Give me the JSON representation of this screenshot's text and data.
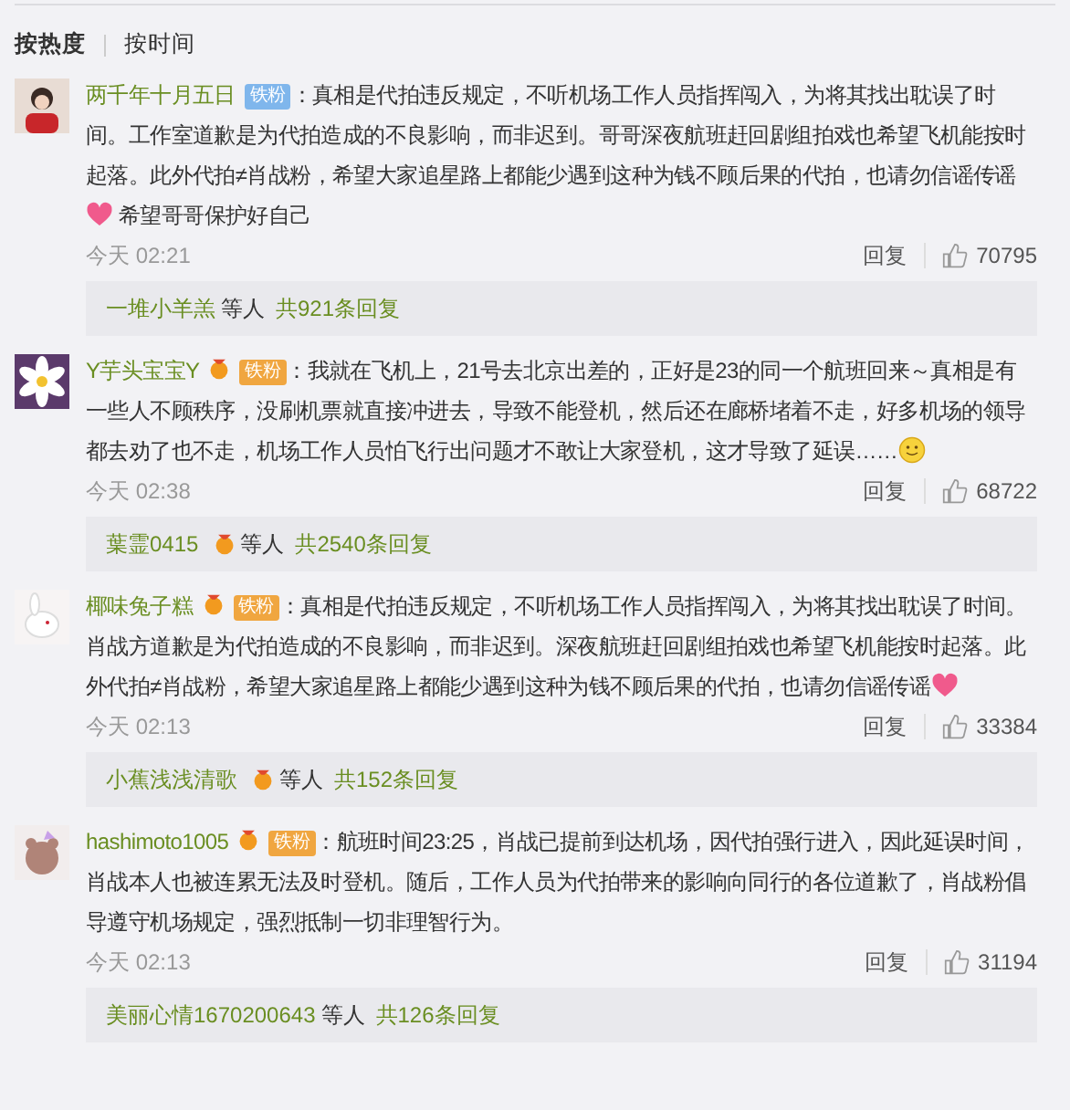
{
  "sort_tabs": [
    {
      "label": "按热度",
      "selected": true
    },
    {
      "label": "按时间",
      "selected": false
    }
  ],
  "comments": [
    {
      "user": "两千年十月五日",
      "badge": {
        "kind": "blue",
        "label": "铁粉"
      },
      "parts": [
        {
          "kind": "text",
          "text": "：真相是代拍违反规定，不听机场工作人员指挥闯入，为将其找出耽误了时间。工作室道歉是为代拍造成的不良影响，而非迟到。哥哥深夜航班赶回剧组拍戏也希望飞机能按时起落。此外代拍≠肖战粉，希望大家追星路上都能少遇到这种为钱不顾后果的代拍，也请勿信谣传谣"
        },
        {
          "kind": "heart"
        },
        {
          "kind": "text",
          "text": " 希望哥哥保护好自己"
        }
      ],
      "time": "今天 02:21",
      "reply_label": "回复",
      "likes": "70795",
      "replies": {
        "user": "一堆小羊羔",
        "badge": false,
        "others": "等人",
        "count": "共921条回复"
      }
    },
    {
      "user": "Y芋头宝宝Y",
      "badge": {
        "kind": "orange",
        "label": "铁粉"
      },
      "parts": [
        {
          "kind": "text",
          "text": "：我就在飞机上，21号去北京出差的，正好是23的同一个航班回来～真相是有一些人不顾秩序，没刷机票就直接冲进去，导致不能登机，然后还在廊桥堵着不走，好多机场的领导都去劝了也不走，机场工作人员怕飞行出问题才不敢让大家登机，这才导致了延误……"
        },
        {
          "kind": "smiley"
        }
      ],
      "time": "今天 02:38",
      "reply_label": "回复",
      "likes": "68722",
      "replies": {
        "user": "葉霊0415",
        "badge": true,
        "others": "等人",
        "count": "共2540条回复"
      }
    },
    {
      "user": "椰味兔子糕",
      "badge": {
        "kind": "orange",
        "label": "铁粉"
      },
      "parts": [
        {
          "kind": "text",
          "text": "：真相是代拍违反规定，不听机场工作人员指挥闯入，为将其找出耽误了时间。肖战方道歉是为代拍造成的不良影响，而非迟到。深夜航班赶回剧组拍戏也希望飞机能按时起落。此外代拍≠肖战粉，希望大家追星路上都能少遇到这种为钱不顾后果的代拍，也请勿信谣传谣"
        },
        {
          "kind": "heart"
        }
      ],
      "time": "今天 02:13",
      "reply_label": "回复",
      "likes": "33384",
      "replies": {
        "user": "小蕉浅浅清歌",
        "badge": true,
        "others": "等人",
        "count": "共152条回复"
      }
    },
    {
      "user": "hashimoto1005",
      "badge": {
        "kind": "orange",
        "label": "铁粉"
      },
      "parts": [
        {
          "kind": "text",
          "text": "：航班时间23:25，肖战已提前到达机场，因代拍强行进入，因此延误时间，肖战本人也被连累无法及时登机。随后，工作人员为代拍带来的影响向同行的各位道歉了，肖战粉倡导遵守机场规定，强烈抵制一切非理智行为。"
        }
      ],
      "time": "今天 02:13",
      "reply_label": "回复",
      "likes": "31194",
      "replies": {
        "user": "美丽心情1670200643",
        "badge": false,
        "others": "等人",
        "count": "共126条回复"
      }
    }
  ]
}
